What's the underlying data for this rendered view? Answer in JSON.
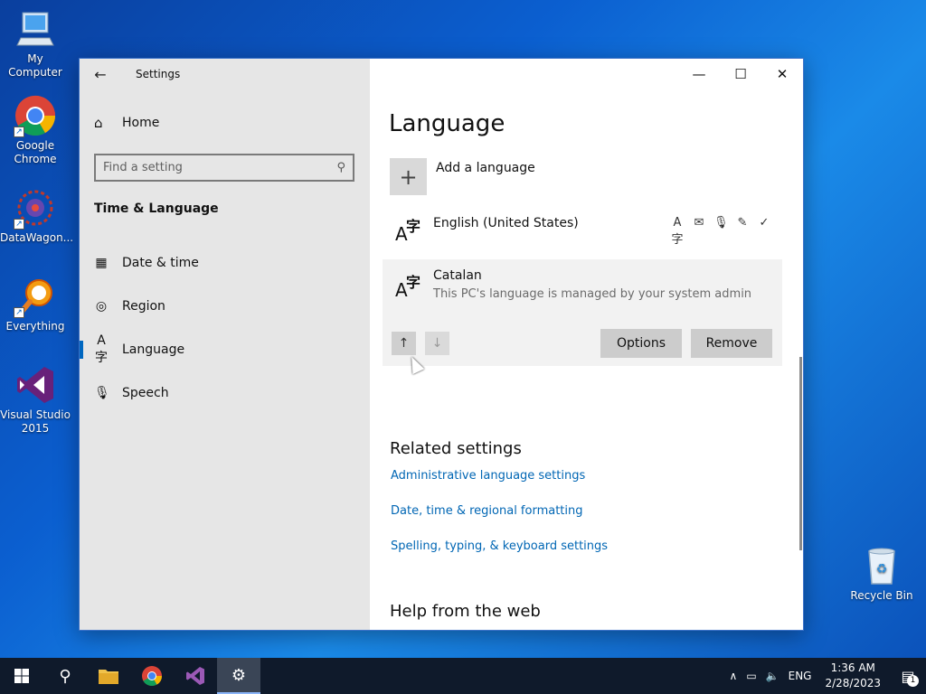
{
  "desktop": {
    "icons": [
      {
        "label": "My Computer"
      },
      {
        "label": "Google Chrome"
      },
      {
        "label": "DataWagon..."
      },
      {
        "label": "Everything"
      },
      {
        "label": "Visual Studio 2015"
      },
      {
        "label": "Recycle Bin"
      }
    ]
  },
  "window": {
    "title": "Settings",
    "controls": {
      "minimize": "—",
      "maximize": "☐",
      "close": "✕"
    }
  },
  "sidebar": {
    "home_label": "Home",
    "search_placeholder": "Find a setting",
    "section_title": "Time & Language",
    "items": [
      {
        "label": "Date & time",
        "icon": "calendar-clock-icon"
      },
      {
        "label": "Region",
        "icon": "globe-icon"
      },
      {
        "label": "Language",
        "icon": "language-icon",
        "active": true
      },
      {
        "label": "Speech",
        "icon": "microphone-icon"
      }
    ]
  },
  "main": {
    "title": "Language",
    "add_language_label": "Add a language",
    "languages": [
      {
        "name": "English (United States)",
        "subtitle": "",
        "feature_icons": [
          "display-language-icon",
          "speech-pack-icon",
          "microphone-icon",
          "handwriting-icon",
          "spellcheck-icon"
        ]
      },
      {
        "name": "Catalan",
        "subtitle": "This PC's language is managed by your system admin"
      }
    ],
    "buttons": {
      "up": "↑",
      "down": "↓",
      "options": "Options",
      "remove": "Remove"
    },
    "related_title": "Related settings",
    "related_links": [
      "Administrative language settings",
      "Date, time & regional formatting",
      "Spelling, typing, & keyboard settings"
    ],
    "help_title": "Help from the web"
  },
  "taskbar": {
    "language": "ENG",
    "time": "1:36 AM",
    "date": "2/28/2023",
    "notification_count": "1"
  }
}
